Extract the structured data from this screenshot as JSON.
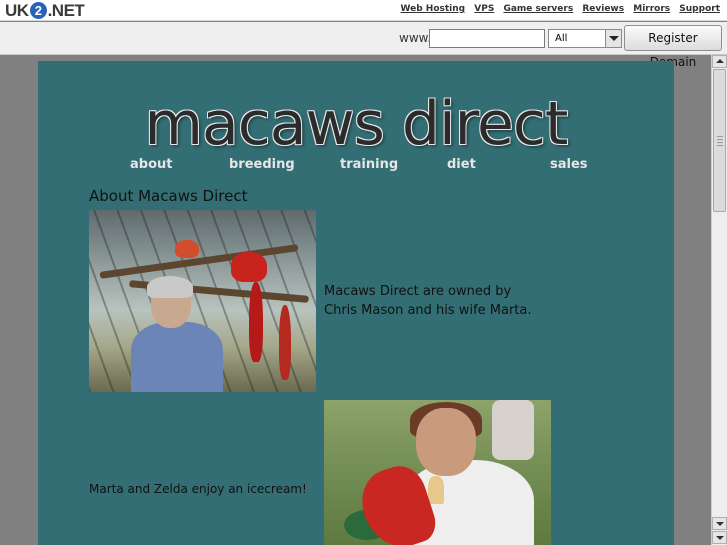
{
  "topbar": {
    "logo_left": "UK",
    "logo_badge": "2",
    "logo_right": ".NET",
    "links": [
      "Web Hosting",
      "VPS",
      "Game servers",
      "Reviews",
      "Mirrors",
      "Support"
    ]
  },
  "domain_search": {
    "www_label": "www.",
    "input_value": "",
    "tld_selected": "All",
    "register_label": "Register Domain"
  },
  "site": {
    "banner_title": "macaws direct",
    "nav": [
      "about",
      "breeding",
      "training",
      "diet",
      "sales"
    ],
    "section_title": "About Macaws Direct",
    "caption_1": "Macaws Direct are owned by Chris Mason and his wife Marta.",
    "caption_2": "Marta and Zelda enjoy an icecream!"
  },
  "colors": {
    "page_background": "#326e74",
    "outer_background": "#808080",
    "nav_text": "#e6e6e6"
  }
}
